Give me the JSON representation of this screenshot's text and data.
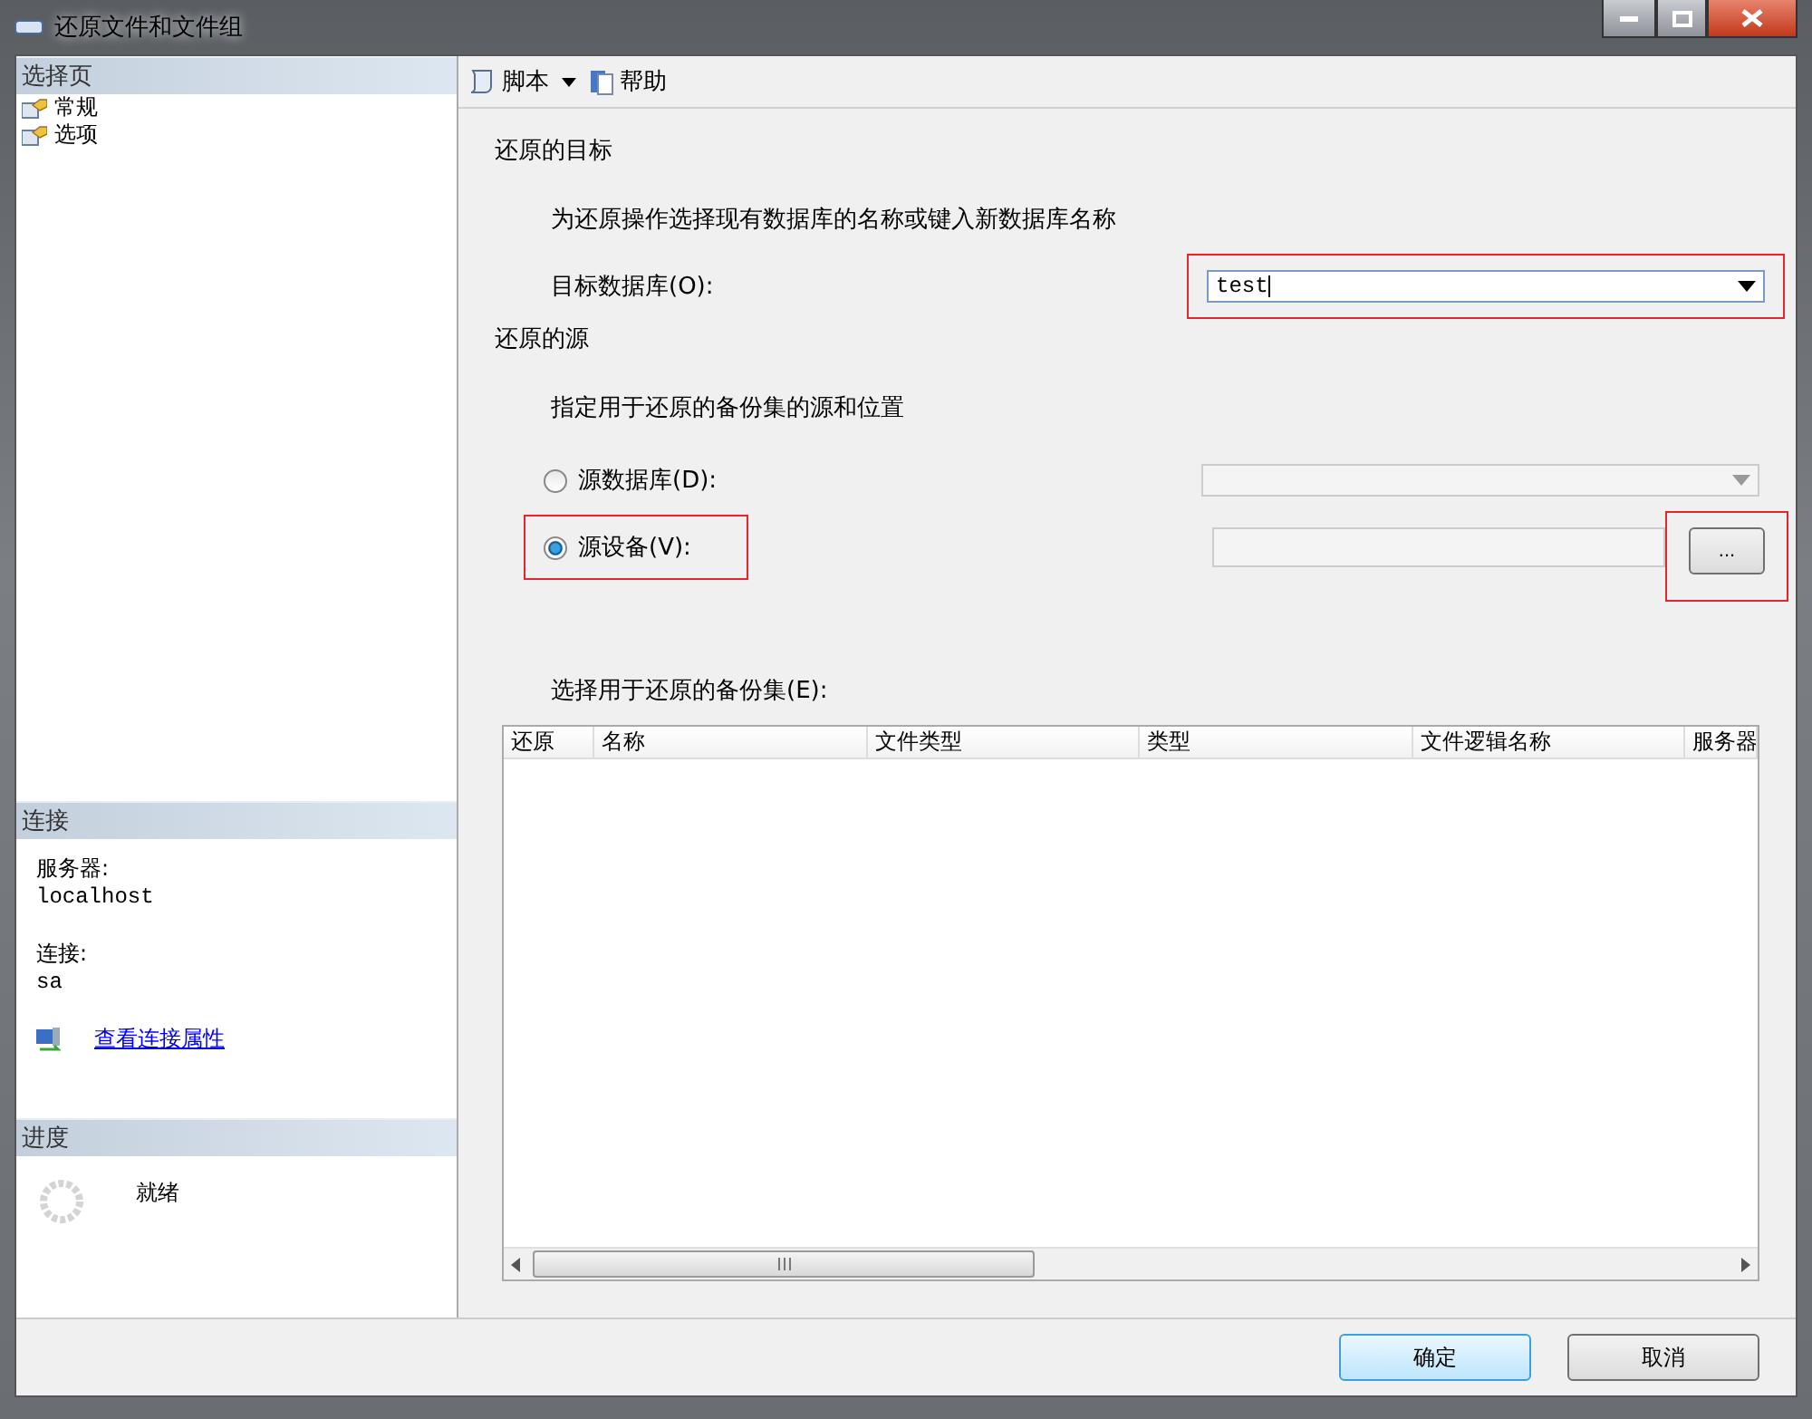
{
  "window": {
    "title": "还原文件和文件组"
  },
  "sidebar": {
    "header": "选择页",
    "items": [
      {
        "label": "常规",
        "selected": false
      },
      {
        "label": "选项",
        "selected": false
      }
    ]
  },
  "connection": {
    "header": "连接",
    "server_label": "服务器:",
    "server": "localhost",
    "login_label": "连接:",
    "login": "sa",
    "link": "查看连接属性"
  },
  "progress": {
    "header": "进度",
    "status": "就绪"
  },
  "toolbar": {
    "script": "脚本",
    "help": "帮助"
  },
  "destination": {
    "heading": "还原的目标",
    "hint": "为还原操作选择现有数据库的名称或键入新数据库名称",
    "label": "目标数据库(O):",
    "value": "test",
    "highlighted": true
  },
  "source": {
    "heading": "还原的源",
    "hint": "指定用于还原的备份集的源和位置",
    "options": [
      {
        "label": "源数据库(D):",
        "selected": false,
        "kind": "dropdown",
        "highlighted": false
      },
      {
        "label": "源设备(V):",
        "selected": true,
        "kind": "path",
        "highlighted": true,
        "button": "...",
        "button_highlighted": true
      }
    ]
  },
  "backup_sets": {
    "label": "选择用于还原的备份集(E):",
    "columns": [
      "还原",
      "名称",
      "文件类型",
      "类型",
      "文件逻辑名称",
      "服务器"
    ]
  },
  "buttons": [
    {
      "label": "确定",
      "default": true
    },
    {
      "label": "取消",
      "default": false
    }
  ]
}
